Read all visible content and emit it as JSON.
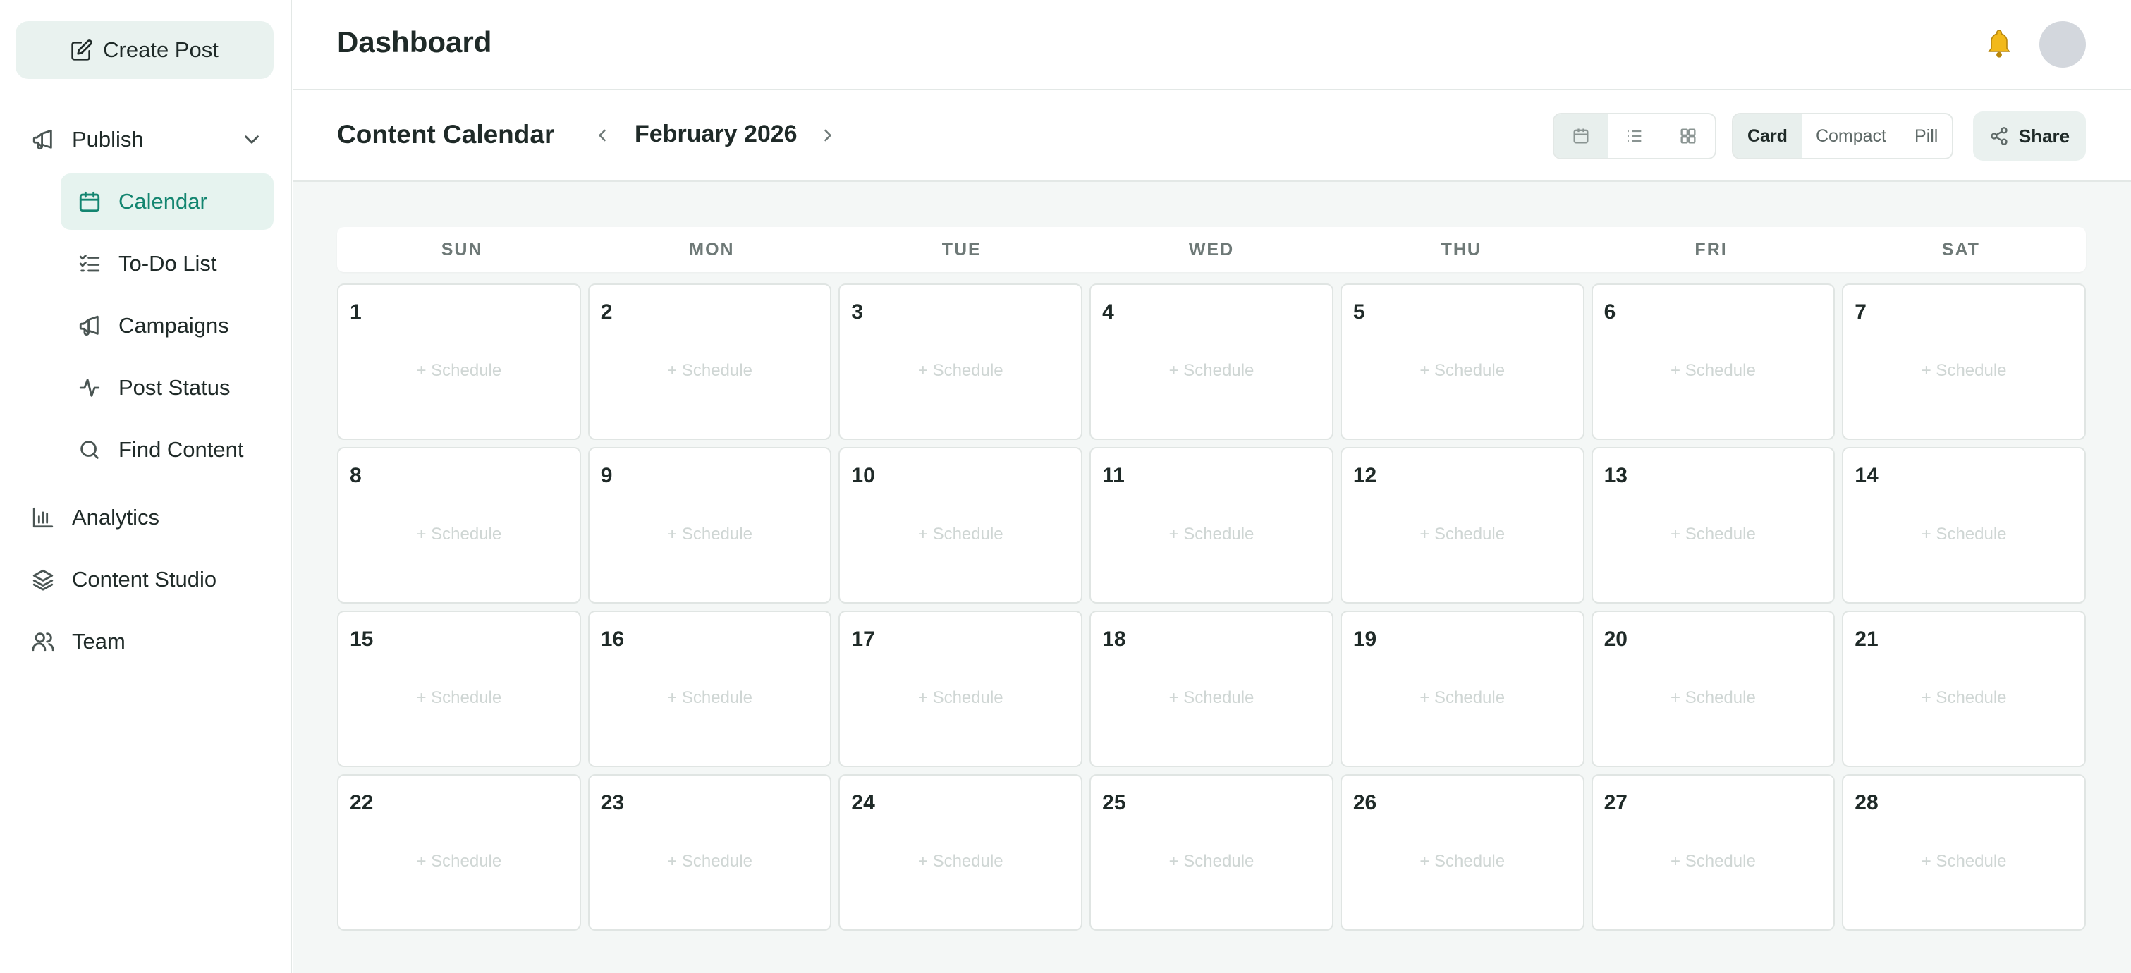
{
  "sidebar": {
    "create_post": "Create Post",
    "publish": {
      "label": "Publish",
      "icon": "megaphone-icon"
    },
    "sub_items": [
      {
        "label": "Calendar",
        "icon": "calendar-icon",
        "active": true
      },
      {
        "label": "To-Do List",
        "icon": "checklist-icon",
        "active": false
      },
      {
        "label": "Campaigns",
        "icon": "megaphone-icon",
        "active": false
      },
      {
        "label": "Post Status",
        "icon": "activity-icon",
        "active": false
      },
      {
        "label": "Find Content",
        "icon": "search-icon",
        "active": false
      }
    ],
    "bottom_items": [
      {
        "label": "Analytics",
        "icon": "bar-chart-icon"
      },
      {
        "label": "Content Studio",
        "icon": "layers-icon"
      },
      {
        "label": "Team",
        "icon": "users-icon"
      }
    ]
  },
  "header": {
    "title": "Dashboard"
  },
  "toolbar": {
    "title": "Content Calendar",
    "month": "February 2026",
    "views": [
      "calendar-view-icon",
      "list-view-icon",
      "grid-view-icon"
    ],
    "styles": [
      "Card",
      "Compact",
      "Pill"
    ],
    "active_style": "Card",
    "share": "Share"
  },
  "calendar": {
    "weekdays": [
      "SUN",
      "MON",
      "TUE",
      "WED",
      "THU",
      "FRI",
      "SAT"
    ],
    "days": [
      "1",
      "2",
      "3",
      "4",
      "5",
      "6",
      "7",
      "8",
      "9",
      "10",
      "11",
      "12",
      "13",
      "14",
      "15",
      "16",
      "17",
      "18",
      "19",
      "20",
      "21",
      "22",
      "23",
      "24",
      "25",
      "26",
      "27",
      "28"
    ],
    "schedule_label": "+ Schedule"
  },
  "colors": {
    "accent": "#138570",
    "active_bg": "#e6f3ef",
    "canvas": "#f4f7f6"
  }
}
